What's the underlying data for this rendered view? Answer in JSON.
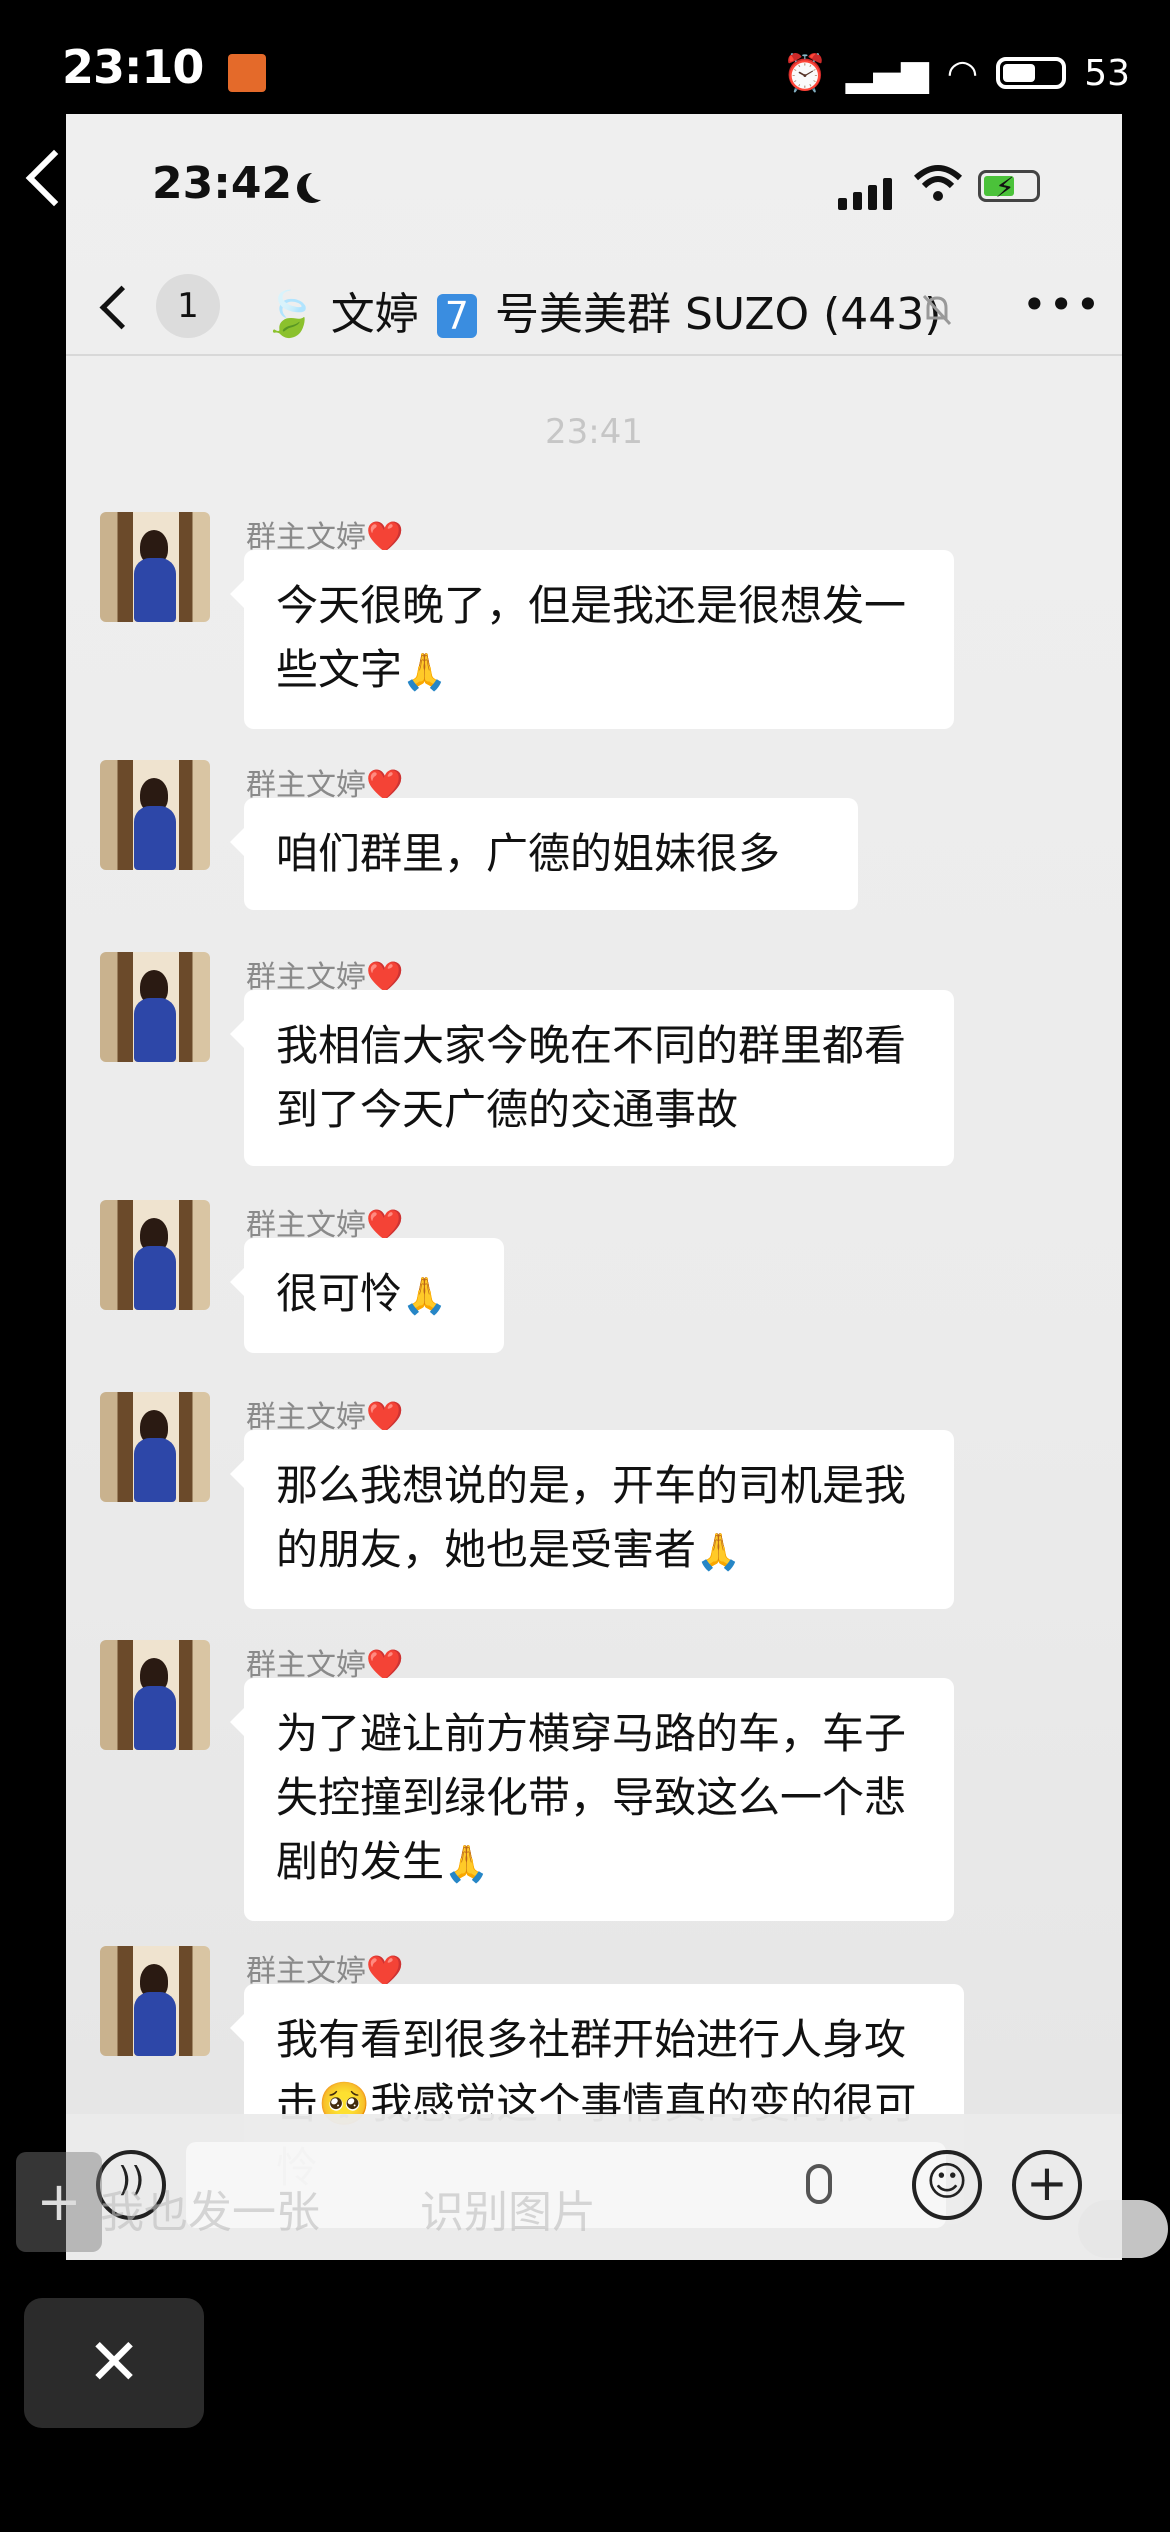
{
  "outer_status": {
    "time": "23:10",
    "battery": "53"
  },
  "inner_status": {
    "time": "23:42"
  },
  "nav": {
    "unread_count": "1",
    "title_leaf": "🍃",
    "title_name": "文婷",
    "title_number": "7",
    "title_rest": "号美美群 SUZO",
    "member_count": "(443)",
    "more": "•••"
  },
  "faint_timestamp": "23:41",
  "messages": [
    {
      "sender": "群主文婷",
      "text": "今天很晚了，但是我还是很想发一些文字",
      "emoji": "🙏"
    },
    {
      "sender": "群主文婷",
      "text": "咱们群里，广德的姐妹很多",
      "emoji": ""
    },
    {
      "sender": "群主文婷",
      "text": "我相信大家今晚在不同的群里都看到了今天广德的交通事故",
      "emoji": ""
    },
    {
      "sender": "群主文婷",
      "text": "很可怜",
      "emoji": "🙏"
    },
    {
      "sender": "群主文婷",
      "text": "那么我想说的是，开车的司机是我的朋友，她也是受害者",
      "emoji": "🙏"
    },
    {
      "sender": "群主文婷",
      "text": "为了避让前方横穿马路的车，车子失控撞到绿化带，导致这么一个悲剧的发生",
      "emoji": "🙏"
    },
    {
      "sender": "群主文婷",
      "text_a": "我有看到很多社群开始进行人身攻击",
      "emoji": "🥺",
      "text_b": "我感觉这个事情真的变的很可怜"
    }
  ],
  "heart": "❤️",
  "overlay": {
    "left_text": "我也发一张",
    "right_text": "识别图片",
    "close": "✕",
    "plus": "+"
  },
  "icons": [
    "back-icon",
    "voice-icon",
    "mic-icon",
    "emoji-icon",
    "plus-icon",
    "close-icon",
    "mute-icon",
    "more-icon"
  ]
}
